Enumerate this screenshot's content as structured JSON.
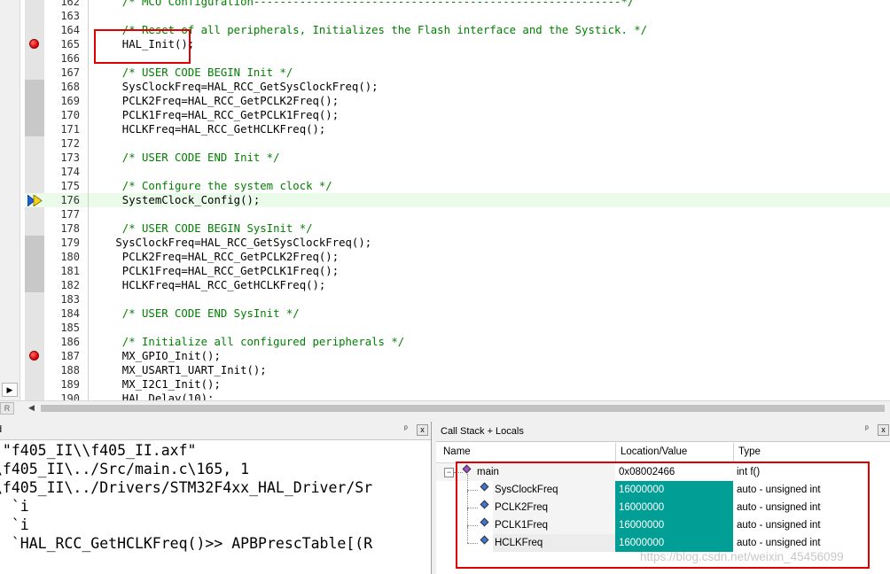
{
  "editor": {
    "lines": [
      {
        "num": "162",
        "code": "  /* MCU Configuration--------------------------------------------------------*/",
        "kind": "comment",
        "marker": ""
      },
      {
        "num": "163",
        "code": "",
        "kind": "code",
        "marker": ""
      },
      {
        "num": "164",
        "code": "  /* Reset of all peripherals, Initializes the Flash interface and the Systick. */",
        "kind": "comment",
        "marker": ""
      },
      {
        "num": "165",
        "code": "  HAL_Init();",
        "kind": "code",
        "marker": "breakpoint"
      },
      {
        "num": "166",
        "code": "",
        "kind": "code",
        "marker": ""
      },
      {
        "num": "167",
        "code": "  /* USER CODE BEGIN Init */",
        "kind": "comment",
        "marker": ""
      },
      {
        "num": "168",
        "code": "  SysClockFreq=HAL_RCC_GetSysClockFreq();",
        "kind": "code",
        "marker": "grey"
      },
      {
        "num": "169",
        "code": "  PCLK2Freq=HAL_RCC_GetPCLK2Freq();",
        "kind": "code",
        "marker": "grey"
      },
      {
        "num": "170",
        "code": "  PCLK1Freq=HAL_RCC_GetPCLK1Freq();",
        "kind": "code",
        "marker": "grey"
      },
      {
        "num": "171",
        "code": "  HCLKFreq=HAL_RCC_GetHCLKFreq();",
        "kind": "code",
        "marker": "grey"
      },
      {
        "num": "172",
        "code": "",
        "kind": "code",
        "marker": ""
      },
      {
        "num": "173",
        "code": "  /* USER CODE END Init */",
        "kind": "comment",
        "marker": ""
      },
      {
        "num": "174",
        "code": "",
        "kind": "code",
        "marker": ""
      },
      {
        "num": "175",
        "code": "  /* Configure the system clock */",
        "kind": "comment",
        "marker": ""
      },
      {
        "num": "176",
        "code": "  SystemClock_Config();",
        "kind": "code",
        "marker": "current"
      },
      {
        "num": "177",
        "code": "",
        "kind": "code",
        "marker": ""
      },
      {
        "num": "178",
        "code": "  /* USER CODE BEGIN SysInit */",
        "kind": "comment",
        "marker": ""
      },
      {
        "num": "179",
        "code": " SysClockFreq=HAL_RCC_GetSysClockFreq();",
        "kind": "code",
        "marker": "grey"
      },
      {
        "num": "180",
        "code": "  PCLK2Freq=HAL_RCC_GetPCLK2Freq();",
        "kind": "code",
        "marker": "grey"
      },
      {
        "num": "181",
        "code": "  PCLK1Freq=HAL_RCC_GetPCLK1Freq();",
        "kind": "code",
        "marker": "grey"
      },
      {
        "num": "182",
        "code": "  HCLKFreq=HAL_RCC_GetHCLKFreq();",
        "kind": "code",
        "marker": "grey"
      },
      {
        "num": "183",
        "code": "",
        "kind": "code",
        "marker": ""
      },
      {
        "num": "184",
        "code": "  /* USER CODE END SysInit */",
        "kind": "comment",
        "marker": ""
      },
      {
        "num": "185",
        "code": "",
        "kind": "code",
        "marker": ""
      },
      {
        "num": "186",
        "code": "  /* Initialize all configured peripherals */",
        "kind": "comment",
        "marker": ""
      },
      {
        "num": "187",
        "code": "  MX_GPIO_Init();",
        "kind": "code",
        "marker": "breakpoint"
      },
      {
        "num": "188",
        "code": "  MX_USART1_UART_Init();",
        "kind": "code",
        "marker": ""
      },
      {
        "num": "189",
        "code": "  MX_I2C1_Init();",
        "kind": "code",
        "marker": ""
      },
      {
        "num": "190",
        "code": "  HAL_Delay(10);",
        "kind": "code",
        "marker": ""
      }
    ],
    "scroll_left_glyph": "▶",
    "hscroll_left_glyph": "◀",
    "r_tab": "R"
  },
  "command": {
    "title": "d",
    "pin_glyph": "ᵖ",
    "close_glyph": "x",
    "lines": [
      " \"f405_II\\\\f405_II.axf\"",
      "\\f405_II\\../Src/main.c\\165, 1",
      "\\f405_II\\../Drivers/STM32F4xx_HAL_Driver/Sr",
      ", `i",
      ", `i",
      ", `HAL_RCC_GetHCLKFreq()>> APBPrescTable[(R"
    ]
  },
  "callstack": {
    "title": "Call Stack + Locals",
    "pin_glyph": "ᵖ",
    "close_glyph": "x",
    "columns": {
      "name": "Name",
      "location": "Location/Value",
      "type": "Type"
    },
    "rows": [
      {
        "name": "main",
        "value": "0x08002466",
        "type": "int f()",
        "level": 0,
        "expander": "−",
        "icon": "purple"
      },
      {
        "name": "SysClockFreq",
        "value": "16000000",
        "type": "auto - unsigned int",
        "level": 1,
        "expander": "",
        "icon": "blue"
      },
      {
        "name": "PCLK2Freq",
        "value": "16000000",
        "type": "auto - unsigned int",
        "level": 1,
        "expander": "",
        "icon": "blue"
      },
      {
        "name": "PCLK1Freq",
        "value": "16000000",
        "type": "auto - unsigned int",
        "level": 1,
        "expander": "",
        "icon": "blue"
      },
      {
        "name": "HCLKFreq",
        "value": "16000000",
        "type": "auto - unsigned int",
        "level": 1,
        "expander": "",
        "icon": "blue"
      }
    ]
  },
  "watermark": "https://blog.csdn.net/weixin_45456099",
  "colors": {
    "comment": "#008000",
    "value_bg": "#009e94",
    "highlight_box": "#e00000",
    "current_line": "#eafbea"
  }
}
